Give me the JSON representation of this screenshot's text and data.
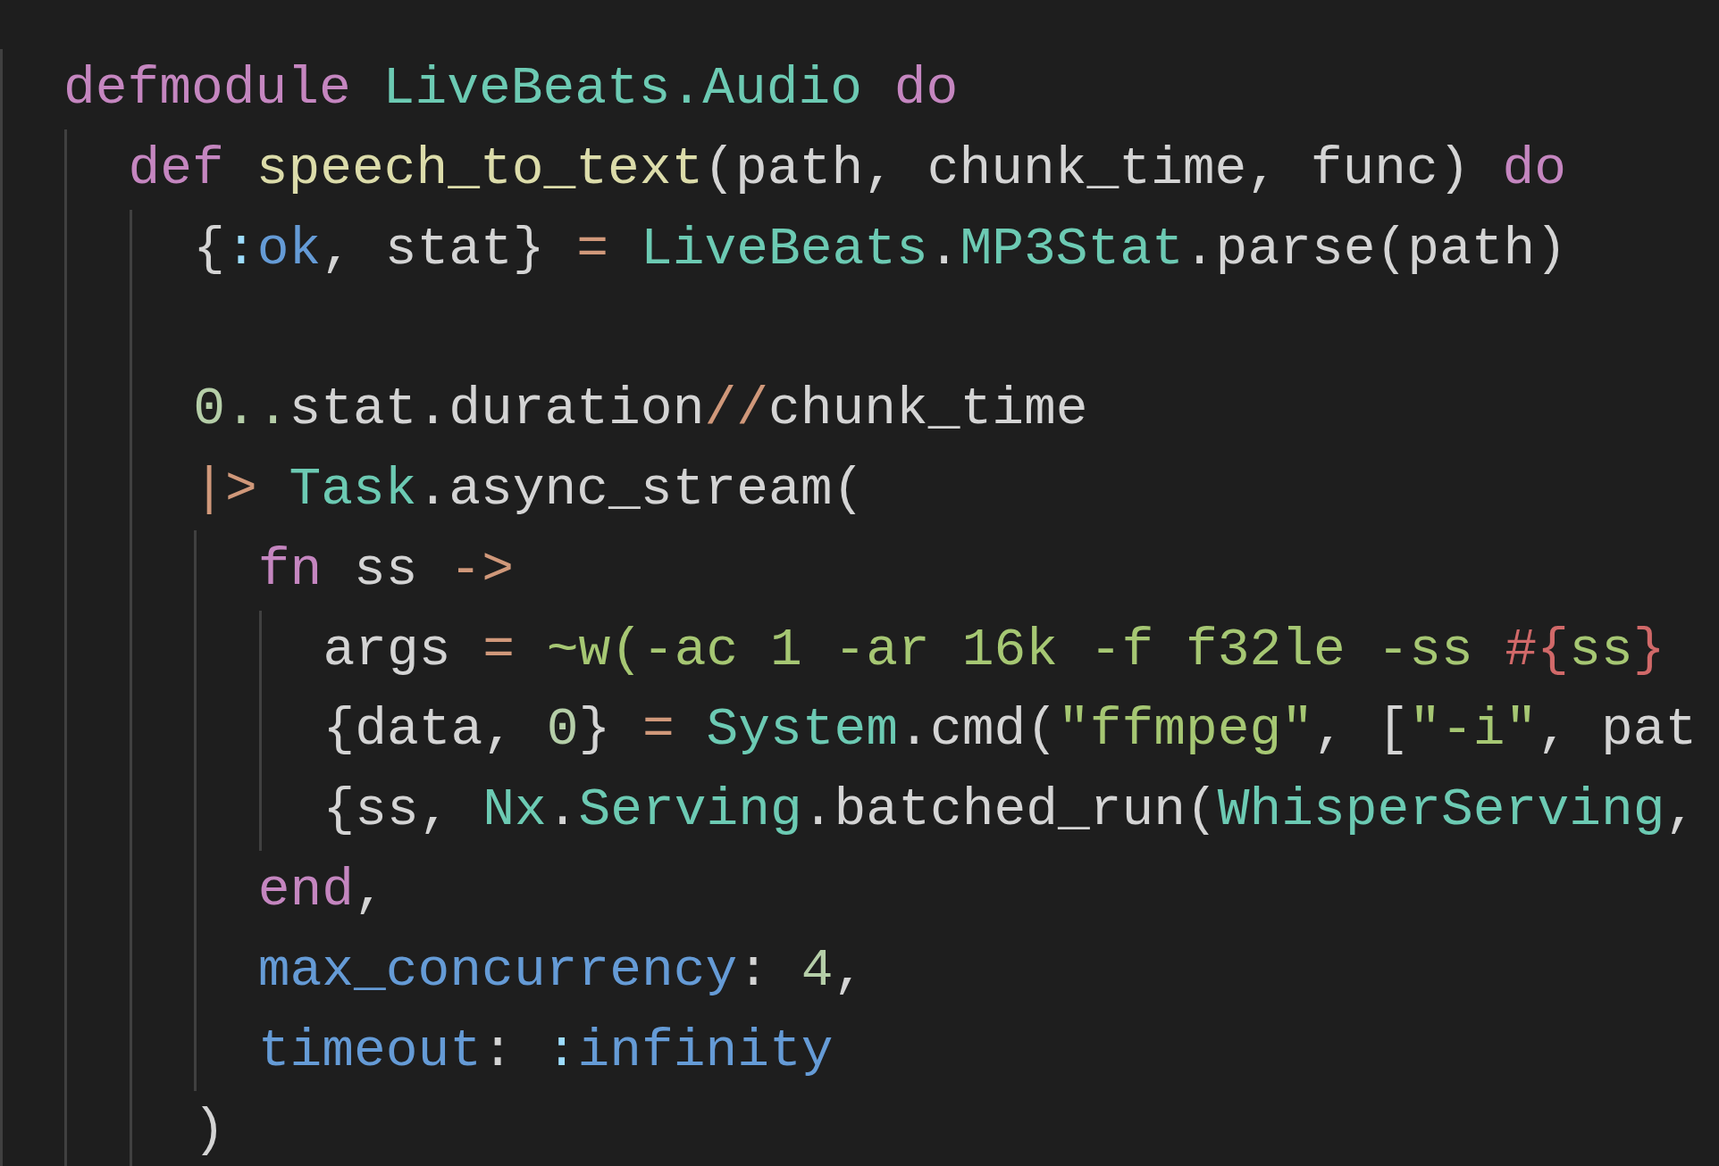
{
  "code": [
    {
      "kind": "code",
      "tokens": [
        {
          "text": "defmodule",
          "kind": "keyword"
        },
        {
          "text": " LiveBeats.Audio",
          "kind": "module"
        },
        {
          "text": " do",
          "kind": "keyword"
        }
      ],
      "children": [
        {
          "kind": "code",
          "tokens": [
            {
              "text": "def",
              "kind": "keyword"
            },
            {
              "text": " speech_to_text",
              "kind": "function"
            },
            {
              "text": "(path, chunk_time, func)",
              "kind": "plain"
            },
            {
              "text": " do",
              "kind": "keyword"
            }
          ],
          "children": [
            {
              "kind": "code",
              "tokens": [
                {
                  "text": "{",
                  "kind": "plain"
                },
                {
                  "text": ":",
                  "kind": "atom_colon"
                },
                {
                  "text": "ok",
                  "kind": "atom"
                },
                {
                  "text": ", stat}",
                  "kind": "plain"
                },
                {
                  "text": " =",
                  "kind": "operator"
                },
                {
                  "text": " LiveBeats",
                  "kind": "module"
                },
                {
                  "text": ".",
                  "kind": "plain"
                },
                {
                  "text": "MP3Stat",
                  "kind": "module"
                },
                {
                  "text": ".parse(path)",
                  "kind": "plain"
                }
              ]
            },
            {
              "kind": "blank"
            },
            {
              "kind": "code",
              "tokens": [
                {
                  "text": "0..",
                  "kind": "number"
                },
                {
                  "text": "stat.duration",
                  "kind": "plain"
                },
                {
                  "text": "//",
                  "kind": "operator"
                },
                {
                  "text": "chunk_time",
                  "kind": "plain"
                }
              ]
            },
            {
              "kind": "code",
              "tokens": [
                {
                  "text": "|>",
                  "kind": "operator"
                },
                {
                  "text": " Task",
                  "kind": "module"
                },
                {
                  "text": ".async_stream(",
                  "kind": "plain"
                }
              ],
              "children": [
                {
                  "kind": "code",
                  "tokens": [
                    {
                      "text": "fn",
                      "kind": "keyword"
                    },
                    {
                      "text": " ss",
                      "kind": "plain"
                    },
                    {
                      "text": " ->",
                      "kind": "operator"
                    }
                  ],
                  "children": [
                    {
                      "kind": "code",
                      "tokens": [
                        {
                          "text": "args",
                          "kind": "plain"
                        },
                        {
                          "text": " =",
                          "kind": "operator"
                        },
                        {
                          "text": " ~w(-ac 1 -ar 16k -f f32le -ss",
                          "kind": "string"
                        },
                        {
                          "text": " #{",
                          "kind": "interp"
                        },
                        {
                          "text": "ss",
                          "kind": "string"
                        },
                        {
                          "text": "}",
                          "kind": "interp"
                        }
                      ]
                    },
                    {
                      "kind": "code",
                      "tokens": [
                        {
                          "text": "{data,",
                          "kind": "plain"
                        },
                        {
                          "text": " 0",
                          "kind": "number"
                        },
                        {
                          "text": "}",
                          "kind": "plain"
                        },
                        {
                          "text": " =",
                          "kind": "operator"
                        },
                        {
                          "text": " System",
                          "kind": "module"
                        },
                        {
                          "text": ".cmd(",
                          "kind": "plain"
                        },
                        {
                          "text": "\"ffmpeg\"",
                          "kind": "string"
                        },
                        {
                          "text": ", [",
                          "kind": "plain"
                        },
                        {
                          "text": "\"-i\"",
                          "kind": "string"
                        },
                        {
                          "text": ", pat",
                          "kind": "plain"
                        }
                      ]
                    },
                    {
                      "kind": "code",
                      "tokens": [
                        {
                          "text": "{ss,",
                          "kind": "plain"
                        },
                        {
                          "text": " Nx",
                          "kind": "module"
                        },
                        {
                          "text": ".",
                          "kind": "plain"
                        },
                        {
                          "text": "Serving",
                          "kind": "module"
                        },
                        {
                          "text": ".batched_run(",
                          "kind": "plain"
                        },
                        {
                          "text": "WhisperServing",
                          "kind": "module"
                        },
                        {
                          "text": ",",
                          "kind": "plain"
                        }
                      ]
                    }
                  ]
                },
                {
                  "kind": "code",
                  "tokens": [
                    {
                      "text": "end",
                      "kind": "keyword"
                    },
                    {
                      "text": ",",
                      "kind": "plain"
                    }
                  ]
                },
                {
                  "kind": "code",
                  "tokens": [
                    {
                      "text": "max_concurrency",
                      "kind": "atom"
                    },
                    {
                      "text": ":",
                      "kind": "plain"
                    },
                    {
                      "text": " 4",
                      "kind": "number"
                    },
                    {
                      "text": ",",
                      "kind": "plain"
                    }
                  ]
                },
                {
                  "kind": "code",
                  "tokens": [
                    {
                      "text": "timeout",
                      "kind": "atom"
                    },
                    {
                      "text": ":",
                      "kind": "plain"
                    },
                    {
                      "text": " :",
                      "kind": "atom_colon"
                    },
                    {
                      "text": "infinity",
                      "kind": "atom"
                    }
                  ]
                }
              ]
            },
            {
              "kind": "code",
              "tokens": [
                {
                  "text": ")",
                  "kind": "plain"
                }
              ]
            }
          ]
        }
      ]
    }
  ]
}
